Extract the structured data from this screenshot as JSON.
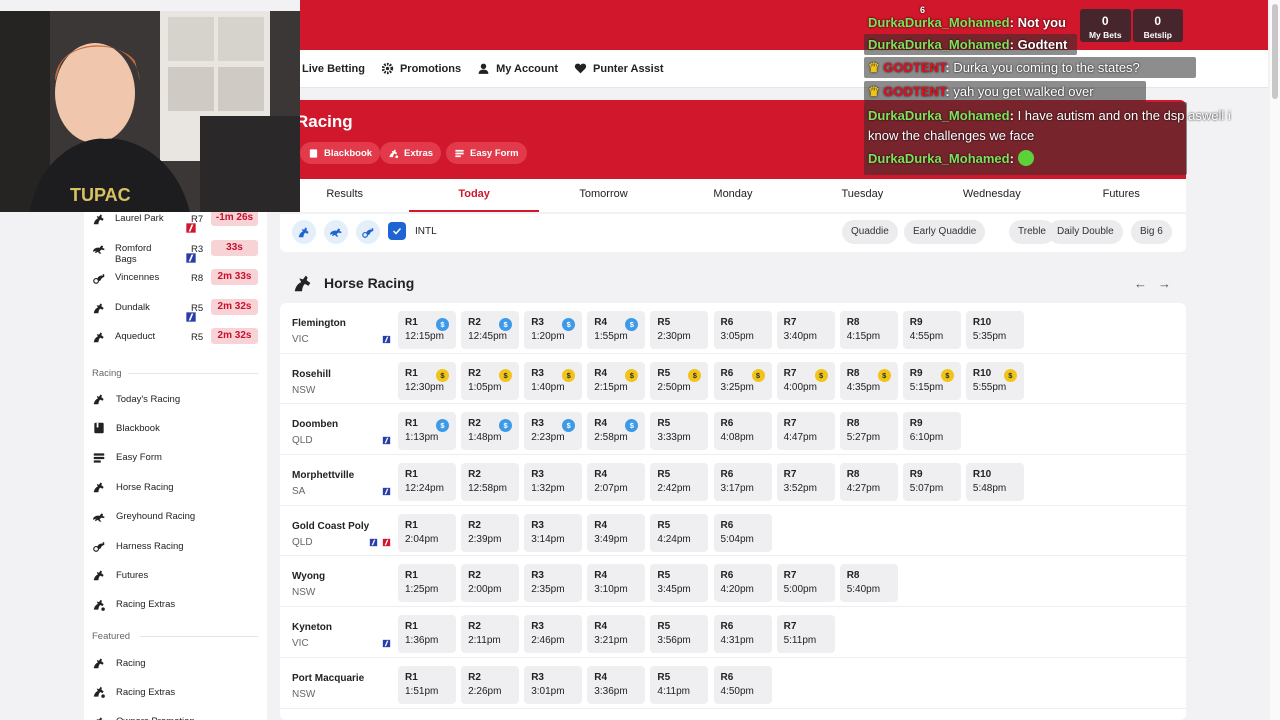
{
  "nav": {
    "items": [
      {
        "label": "Live Betting",
        "icon": "live-betting-icon"
      },
      {
        "label": "Promotions",
        "icon": "gear-icon"
      },
      {
        "label": "My Account",
        "icon": "user-icon"
      },
      {
        "label": "Punter Assist",
        "icon": "heart-icon"
      }
    ]
  },
  "racing_header": {
    "title": "Racing",
    "pills": [
      "Blackbook",
      "Extras",
      "Easy Form"
    ]
  },
  "day_tabs": [
    "Results",
    "Today",
    "Tomorrow",
    "Monday",
    "Tuesday",
    "Wednesday",
    "Futures"
  ],
  "active_day_tab": "Today",
  "filters": {
    "intl_label": "INTL",
    "intl_checked": true,
    "bet_types": [
      "Quaddie",
      "Early Quaddie",
      "Treble",
      "Daily Double",
      "Big 6"
    ]
  },
  "section": {
    "title": "Horse Racing",
    "prev": "←",
    "next": "→"
  },
  "meetings": [
    {
      "venue": "Flemington",
      "state": "VIC",
      "flags": [
        "blue"
      ],
      "races": [
        {
          "num": "R1",
          "time": "12:15pm",
          "badge": "blue"
        },
        {
          "num": "R2",
          "time": "12:45pm",
          "badge": "blue"
        },
        {
          "num": "R3",
          "time": "1:20pm",
          "badge": "blue"
        },
        {
          "num": "R4",
          "time": "1:55pm",
          "badge": "blue"
        },
        {
          "num": "R5",
          "time": "2:30pm"
        },
        {
          "num": "R6",
          "time": "3:05pm"
        },
        {
          "num": "R7",
          "time": "3:40pm"
        },
        {
          "num": "R8",
          "time": "4:15pm"
        },
        {
          "num": "R9",
          "time": "4:55pm"
        },
        {
          "num": "R10",
          "time": "5:35pm"
        }
      ]
    },
    {
      "venue": "Rosehill",
      "state": "NSW",
      "flags": [],
      "races": [
        {
          "num": "R1",
          "time": "12:30pm",
          "badge": "gold"
        },
        {
          "num": "R2",
          "time": "1:05pm",
          "badge": "gold"
        },
        {
          "num": "R3",
          "time": "1:40pm",
          "badge": "gold"
        },
        {
          "num": "R4",
          "time": "2:15pm",
          "badge": "gold"
        },
        {
          "num": "R5",
          "time": "2:50pm",
          "badge": "gold"
        },
        {
          "num": "R6",
          "time": "3:25pm",
          "badge": "gold"
        },
        {
          "num": "R7",
          "time": "4:00pm",
          "badge": "gold"
        },
        {
          "num": "R8",
          "time": "4:35pm",
          "badge": "gold"
        },
        {
          "num": "R9",
          "time": "5:15pm",
          "badge": "gold"
        },
        {
          "num": "R10",
          "time": "5:55pm",
          "badge": "gold"
        }
      ]
    },
    {
      "venue": "Doomben",
      "state": "QLD",
      "flags": [
        "blue"
      ],
      "races": [
        {
          "num": "R1",
          "time": "1:13pm",
          "badge": "blue"
        },
        {
          "num": "R2",
          "time": "1:48pm",
          "badge": "blue"
        },
        {
          "num": "R3",
          "time": "2:23pm",
          "badge": "blue"
        },
        {
          "num": "R4",
          "time": "2:58pm",
          "badge": "blue"
        },
        {
          "num": "R5",
          "time": "3:33pm"
        },
        {
          "num": "R6",
          "time": "4:08pm"
        },
        {
          "num": "R7",
          "time": "4:47pm"
        },
        {
          "num": "R8",
          "time": "5:27pm"
        },
        {
          "num": "R9",
          "time": "6:10pm"
        }
      ]
    },
    {
      "venue": "Morphettville",
      "state": "SA",
      "flags": [
        "blue"
      ],
      "races": [
        {
          "num": "R1",
          "time": "12:24pm"
        },
        {
          "num": "R2",
          "time": "12:58pm"
        },
        {
          "num": "R3",
          "time": "1:32pm"
        },
        {
          "num": "R4",
          "time": "2:07pm"
        },
        {
          "num": "R5",
          "time": "2:42pm"
        },
        {
          "num": "R6",
          "time": "3:17pm"
        },
        {
          "num": "R7",
          "time": "3:52pm"
        },
        {
          "num": "R8",
          "time": "4:27pm"
        },
        {
          "num": "R9",
          "time": "5:07pm"
        },
        {
          "num": "R10",
          "time": "5:48pm"
        }
      ]
    },
    {
      "venue": "Gold Coast Poly",
      "state": "QLD",
      "flags": [
        "blue",
        "red"
      ],
      "races": [
        {
          "num": "R1",
          "time": "2:04pm"
        },
        {
          "num": "R2",
          "time": "2:39pm"
        },
        {
          "num": "R3",
          "time": "3:14pm"
        },
        {
          "num": "R4",
          "time": "3:49pm"
        },
        {
          "num": "R5",
          "time": "4:24pm"
        },
        {
          "num": "R6",
          "time": "5:04pm"
        }
      ]
    },
    {
      "venue": "Wyong",
      "state": "NSW",
      "flags": [],
      "races": [
        {
          "num": "R1",
          "time": "1:25pm"
        },
        {
          "num": "R2",
          "time": "2:00pm"
        },
        {
          "num": "R3",
          "time": "2:35pm"
        },
        {
          "num": "R4",
          "time": "3:10pm"
        },
        {
          "num": "R5",
          "time": "3:45pm"
        },
        {
          "num": "R6",
          "time": "4:20pm"
        },
        {
          "num": "R7",
          "time": "5:00pm"
        },
        {
          "num": "R8",
          "time": "5:40pm"
        }
      ]
    },
    {
      "venue": "Kyneton",
      "state": "VIC",
      "flags": [
        "blue"
      ],
      "races": [
        {
          "num": "R1",
          "time": "1:36pm"
        },
        {
          "num": "R2",
          "time": "2:11pm"
        },
        {
          "num": "R3",
          "time": "2:46pm"
        },
        {
          "num": "R4",
          "time": "3:21pm"
        },
        {
          "num": "R5",
          "time": "3:56pm"
        },
        {
          "num": "R6",
          "time": "4:31pm"
        },
        {
          "num": "R7",
          "time": "5:11pm"
        }
      ]
    },
    {
      "venue": "Port Macquarie",
      "state": "NSW",
      "flags": [],
      "races": [
        {
          "num": "R1",
          "time": "1:51pm"
        },
        {
          "num": "R2",
          "time": "2:26pm"
        },
        {
          "num": "R3",
          "time": "3:01pm"
        },
        {
          "num": "R4",
          "time": "3:36pm"
        },
        {
          "num": "R5",
          "time": "4:11pm"
        },
        {
          "num": "R6",
          "time": "4:50pm"
        }
      ]
    }
  ],
  "next_to_jump": [
    {
      "venue": "Laurel Park",
      "type": "horse",
      "flag": "red",
      "race": "R7",
      "time": "-1m 26s"
    },
    {
      "venue": "Romford Bags",
      "type": "greyhound",
      "flag": "blue",
      "race": "R3",
      "time": "33s"
    },
    {
      "venue": "Vincennes",
      "type": "harness",
      "flag": "",
      "race": "R8",
      "time": "2m 33s"
    },
    {
      "venue": "Dundalk",
      "type": "horse",
      "flag": "blue",
      "race": "R5",
      "time": "2m 32s"
    },
    {
      "venue": "Aqueduct",
      "type": "horse",
      "flag": "",
      "race": "R5",
      "time": "2m 32s"
    }
  ],
  "sidebar": {
    "racing_heading": "Racing",
    "racing_items": [
      {
        "label": "Today's Racing",
        "icon": "horse-icon"
      },
      {
        "label": "Blackbook",
        "icon": "blackbook-icon"
      },
      {
        "label": "Easy Form",
        "icon": "easy-form-icon"
      },
      {
        "label": "Horse Racing",
        "icon": "horse-icon"
      },
      {
        "label": "Greyhound Racing",
        "icon": "greyhound-icon"
      },
      {
        "label": "Harness Racing",
        "icon": "harness-icon"
      },
      {
        "label": "Futures",
        "icon": "horse-icon"
      },
      {
        "label": "Racing Extras",
        "icon": "racing-extras-icon"
      }
    ],
    "featured_heading": "Featured",
    "featured_items": [
      {
        "label": "Racing",
        "icon": "horse-icon"
      },
      {
        "label": "Racing Extras",
        "icon": "racing-extras-icon"
      },
      {
        "label": "Owners Promotion",
        "icon": "horse-icon"
      }
    ]
  },
  "bets": {
    "my_bets_count": "0",
    "my_bets_label": "My Bets",
    "betslip_count": "0",
    "betslip_label": "Betslip"
  },
  "chat": [
    {
      "user": "DurkaDurka_Mohamed",
      "msg": "Godtent"
    },
    {
      "user": "GODTENT",
      "msg": "Durka you coming to the states?"
    },
    {
      "user": "GODTENT",
      "msg": "yah you get walked over"
    },
    {
      "user": "DurkaDurka_Mohamed",
      "msg": "I have autism and on the dsp aswell i",
      "msg2": "know the challenges we face"
    },
    {
      "user": "DurkaDurka_Mohamed",
      "msg": ""
    }
  ],
  "chat_partial": {
    "user": "DurkaDurka_Mohamed",
    "msg": "Not you",
    "count": "6"
  },
  "colors": {
    "brand_red": "#d0172b",
    "countdown_bg": "#f8d3d6",
    "badge_blue": "#3d9ae8",
    "badge_gold": "#f0c419",
    "chat_user": "#7fe05a",
    "chat_user_alt": "#e01020"
  }
}
